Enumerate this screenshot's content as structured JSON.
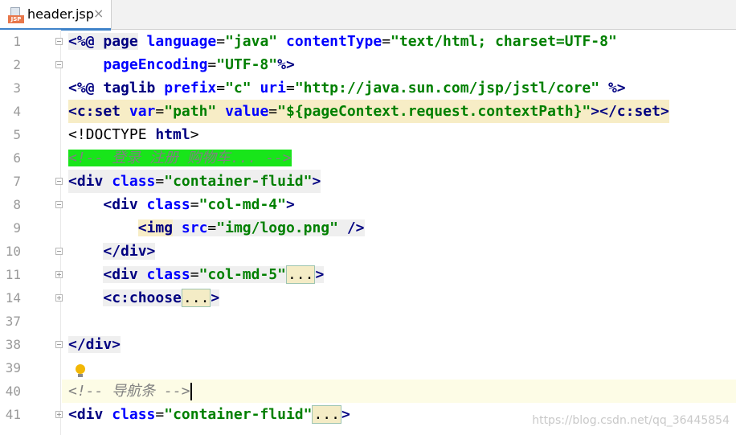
{
  "tab": {
    "filename": "header.jsp",
    "icon_badge": "JSP",
    "close": "×"
  },
  "line_numbers": [
    "1",
    "2",
    "3",
    "4",
    "5",
    "6",
    "7",
    "8",
    "9",
    "10",
    "11",
    "14",
    "37",
    "38",
    "39",
    "40",
    "41"
  ],
  "code": {
    "l1": {
      "tag": "<%@ ",
      "kw": "page",
      "a1": " language",
      "eq1": "=",
      "s1": "\"java\"",
      "a2": " contentType",
      "eq2": "=",
      "s2": "\"text/html; charset=UTF-8\""
    },
    "l2": {
      "a1": "pageEncoding",
      "eq1": "=",
      "s1": "\"UTF-8\"",
      "end": "%>"
    },
    "l3": {
      "tag": "<%@ ",
      "kw": "taglib",
      "a1": " prefix",
      "eq1": "=",
      "s1": "\"c\"",
      "a2": " uri",
      "eq2": "=",
      "s2": "\"http://java.sun.com/jsp/jstl/core\"",
      "end": " %>"
    },
    "l4": {
      "open": "<c:set",
      "a1": " var",
      "eq1": "=",
      "s1": "\"path\"",
      "a2": " value",
      "eq2": "=",
      "s2": "\"${pageContext.request.contextPath}\"",
      "close": "></c:set>"
    },
    "l5": {
      "open": "<!DOCTYPE ",
      "kw": "html",
      "close": ">"
    },
    "l6": {
      "comment": "<!-- 登录 注册 购物车... -->"
    },
    "l7": {
      "open": "<div",
      "a1": " class",
      "eq1": "=",
      "s1": "\"container-fluid\"",
      "close": ">"
    },
    "l8": {
      "open": "<div",
      "a1": " class",
      "eq1": "=",
      "s1": "\"col-md-4\"",
      "close": ">"
    },
    "l9": {
      "open": "<img",
      "a1": " src",
      "eq1": "=",
      "s1": "\"img/logo.png\"",
      "close": " />"
    },
    "l10": {
      "open": "</div>"
    },
    "l11": {
      "open": "<div",
      "a1": " class",
      "eq1": "=",
      "s1": "\"col-md-5\"",
      "dots": "...",
      "close": ">"
    },
    "l14": {
      "open": "<c:choose",
      "dots": "...",
      "close": ">"
    },
    "l38": {
      "open": "</div>"
    },
    "l40": {
      "comment": "<!-- 导航条 -->"
    },
    "l41": {
      "open": "<div",
      "a1": " class",
      "eq1": "=",
      "s1": "\"container-fluid\"",
      "dots": "...",
      "close": ">"
    }
  },
  "watermark": "https://blog.csdn.net/qq_36445854",
  "colors": {
    "tag": "#000080",
    "attribute": "#0000ff",
    "string": "#008000",
    "comment": "#808080",
    "current_line": "#fdfce6",
    "highlight_green": "#18e51a"
  }
}
